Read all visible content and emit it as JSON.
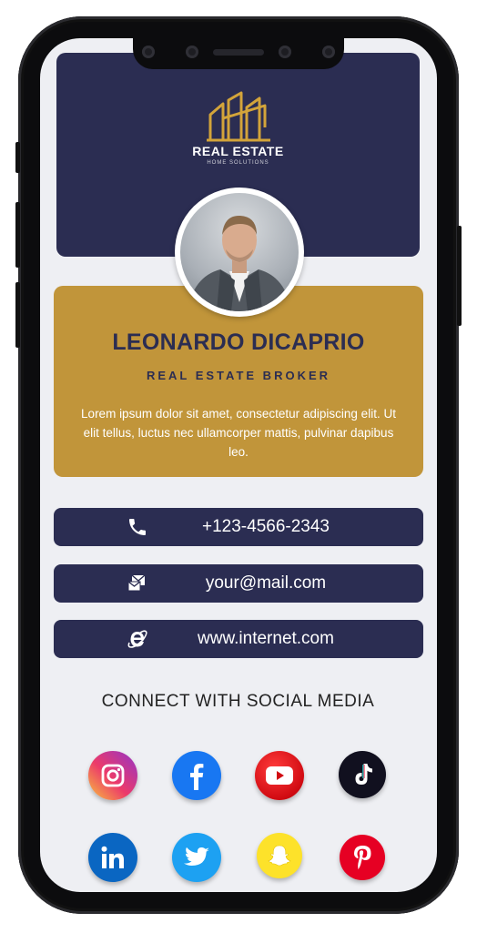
{
  "brand": {
    "line1": "REAL ESTATE",
    "line2": "HOME SOLUTIONS"
  },
  "profile": {
    "name": "LEONARDO DICAPRIO",
    "role": "REAL ESTATE BROKER",
    "bio": "Lorem ipsum dolor sit amet, consectetur adipiscing elit. Ut elit tellus, luctus nec ullamcorper mattis, pulvinar dapibus leo."
  },
  "contacts": {
    "phone": "+123-4566-2343",
    "email": "your@mail.com",
    "website": "www.internet.com"
  },
  "social": {
    "title": "CONNECT WITH SOCIAL MEDIA",
    "icons": [
      "instagram-icon",
      "facebook-icon",
      "youtube-icon",
      "tiktok-icon",
      "linkedin-icon",
      "twitter-icon",
      "snapchat-icon",
      "pinterest-icon"
    ]
  },
  "colors": {
    "navy": "#2b2d52",
    "gold": "#c1953a",
    "background": "#eeeff3"
  }
}
